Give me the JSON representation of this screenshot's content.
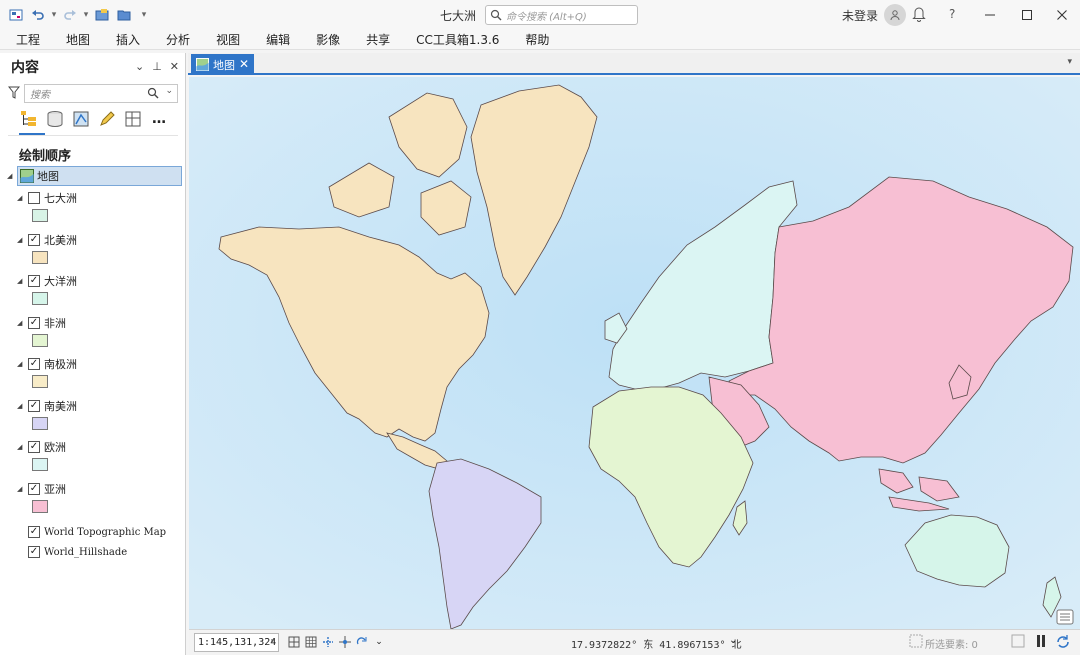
{
  "window": {
    "title": "七大洲",
    "command_search_placeholder": "命令搜索 (Alt+Q)",
    "user": "未登录"
  },
  "menu": [
    "工程",
    "地图",
    "插入",
    "分析",
    "视图",
    "编辑",
    "影像",
    "共享",
    "CC工具箱1.3.6",
    "帮助"
  ],
  "contents": {
    "title": "内容",
    "search_placeholder": "搜索",
    "drawing_order": "绘制顺序",
    "map_name": "地图",
    "layers": [
      {
        "name": "七大洲",
        "checked": false,
        "color": "#d8f3e6"
      },
      {
        "name": "北美洲",
        "checked": true,
        "color": "#f7e4bf"
      },
      {
        "name": "大洋洲",
        "checked": true,
        "color": "#d6f5ea"
      },
      {
        "name": "非洲",
        "checked": true,
        "color": "#e4f5d2"
      },
      {
        "name": "南极洲",
        "checked": true,
        "color": "#f8ecc8"
      },
      {
        "name": "南美洲",
        "checked": true,
        "color": "#d7d5f5"
      },
      {
        "name": "欧洲",
        "checked": true,
        "color": "#dbf5f3"
      },
      {
        "name": "亚洲",
        "checked": true,
        "color": "#f7bfd3"
      }
    ],
    "basemaps": [
      {
        "name": "World Topographic Map",
        "checked": true
      },
      {
        "name": "World_Hillshade",
        "checked": true
      }
    ]
  },
  "map_tab": {
    "label": "地图"
  },
  "status": {
    "scale": "1:145,131,324",
    "coordinates": "17.9372822° 东 41.8967153° 北",
    "selected_features": "所选要素: 0"
  },
  "colors": {
    "accent": "#2f75c8",
    "ocean": "#cfe6f6",
    "north_america": "#f7e4bf",
    "south_america": "#d7d5f5",
    "europe": "#dbf5f3",
    "africa": "#e4f5d2",
    "asia": "#f7bfd3",
    "oceania": "#d6f5ea"
  }
}
